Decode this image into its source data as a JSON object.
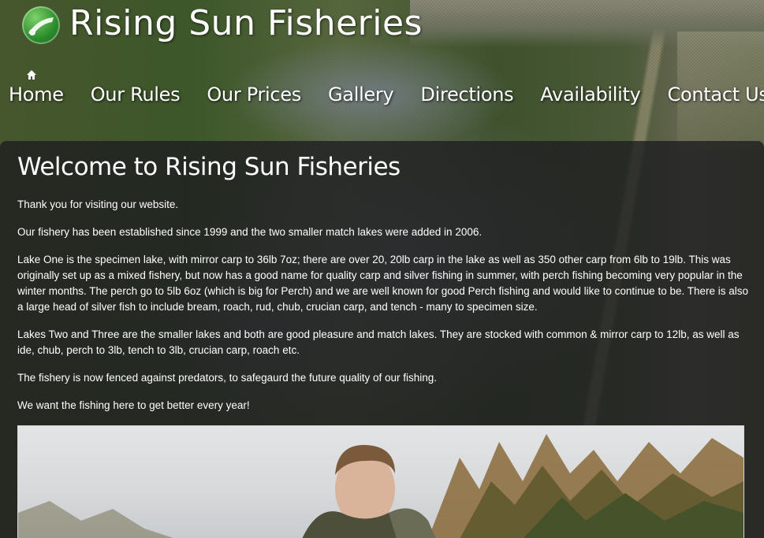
{
  "site": {
    "title": "Rising Sun Fisheries"
  },
  "nav": {
    "items": [
      {
        "label": "Home",
        "icon": "home-icon"
      },
      {
        "label": "Our Rules"
      },
      {
        "label": "Our Prices"
      },
      {
        "label": "Gallery"
      },
      {
        "label": "Directions"
      },
      {
        "label": "Availability"
      },
      {
        "label": "Contact Us"
      }
    ]
  },
  "main": {
    "heading": "Welcome to Rising Sun Fisheries",
    "paragraphs": [
      "Thank you for visiting our website.",
      "Our fishery has been established since 1999 and the two smaller match lakes were added in 2006.",
      "Lake One is the specimen lake, with mirror carp to 36lb 7oz; there are over 20, 20lb carp in the lake as well as 350 other carp from 6lb to 19lb. This was originally set up as a mixed fishery, but now has a good name for quality carp and silver fishing in summer, with perch fishing becoming very popular in the winter months. The perch go to 5lb 6oz (which is big for Perch) and we are well known for good Perch fishing and would like to continue to be. There is also a large head of silver fish to include bream, roach, rud, chub, crucian carp, and tench - many to specimen size.",
      "Lakes Two and Three are the smaller lakes and both are good pleasure and match lakes. They are stocked with common & mirror carp to 12lb, as well as ide, chub, perch to 3lb, tench to 3lb, crucian carp, roach etc.",
      "The fishery is now fenced against predators, to safegaurd the future quality of our fishing.",
      "We want the fishing here to get better every year!"
    ]
  },
  "colors": {
    "text": "#ffffff",
    "panel": "#1e1e20",
    "logo_green": "#2a8a2a"
  }
}
